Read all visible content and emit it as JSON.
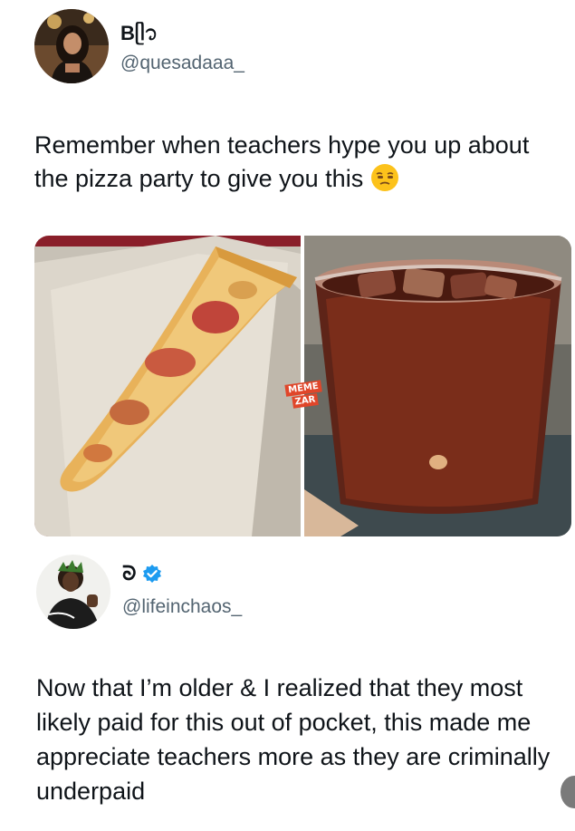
{
  "tweets": [
    {
      "display_name": "Bᥫ᭡",
      "handle": "@quesadaaa_",
      "text": "Remember when teachers hype you up about the pizza party to give you this",
      "emoji": "unamused-face-icon",
      "media_watermark": [
        "MEME",
        "ZAR"
      ]
    },
    {
      "display_name": "ᘐ",
      "handle": "@lifeinchaos_",
      "verified": true,
      "text": "Now that I’m older & I realized that they most likely paid for this out of pocket, this made me appreciate teachers more as they are criminally underpaid"
    }
  ],
  "colors": {
    "text": "#0f1419",
    "handle": "#536471",
    "verified": "#1d9bf0",
    "watermark": "#e0462a"
  }
}
